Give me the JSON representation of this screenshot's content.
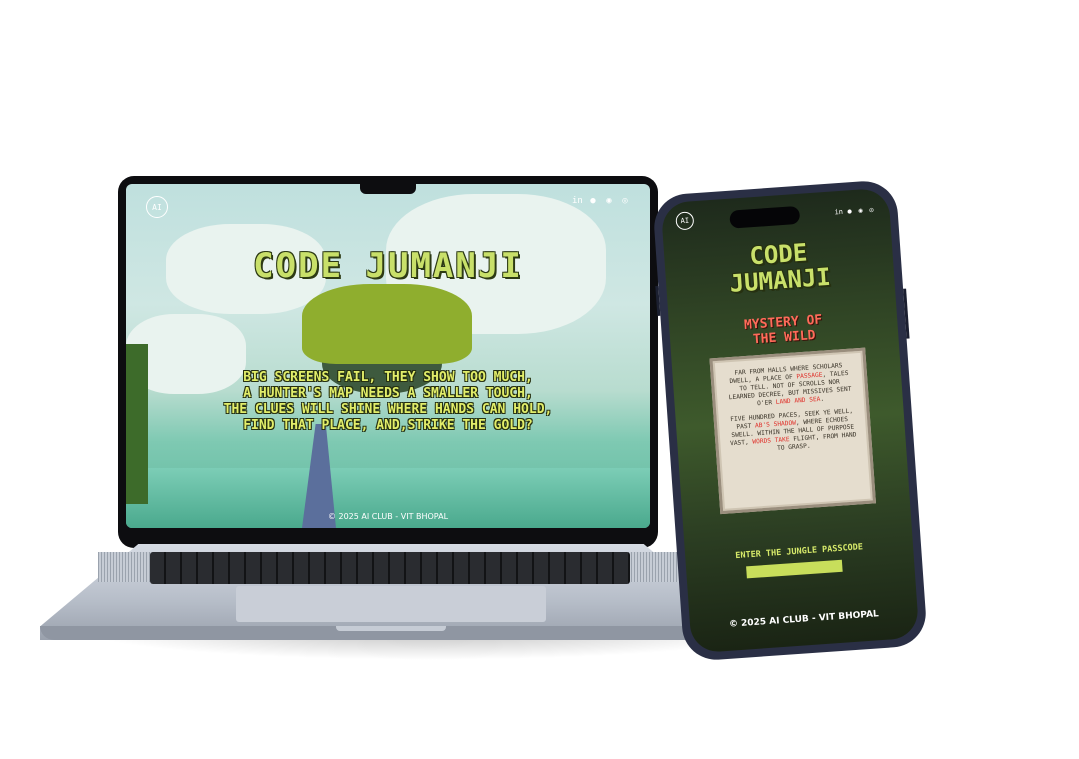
{
  "laptop": {
    "logo": "AI",
    "social_icons": [
      "linkedin-icon",
      "github-icon",
      "discord-icon",
      "instagram-icon"
    ],
    "title": "CODE JUMANJI",
    "poem_lines": [
      "BIG SCREENS FAIL, THEY SHOW TOO MUCH,",
      "A HUNTER'S MAP NEEDS A SMALLER TOUCH,",
      "THE CLUES WILL SHINE WHERE HANDS CAN HOLD,",
      "FIND THAT PLACE, AND,STRIKE THE GOLD?"
    ],
    "footer": "© 2025 AI CLUB - VIT BHOPAL"
  },
  "phone": {
    "logo": "AI",
    "title_line1": "CODE",
    "title_line2": "JUMANJI",
    "subtitle_line1": "MYSTERY OF",
    "subtitle_line2": "THE WILD",
    "stanza1": {
      "pre": "FAR FROM HALLS WHERE SCHOLARS DWELL, A PLACE OF ",
      "hl1": "PASSAGE",
      "mid": ", TALES TO TELL. NOT OF SCROLLS NOR LEARNED DECREE, BUT MISSIVES SENT O'ER ",
      "hl2": "LAND AND SEA",
      "post": "."
    },
    "stanza2": {
      "pre": "FIVE HUNDRED PACES, SEEK YE WELL, PAST ",
      "hl1": "AB'S SHADOW",
      "mid": ", WHERE ECHOES SWELL. WITHIN THE HALL OF PURPOSE VAST, ",
      "hl2": "WORDS TAKE",
      "post": " FLIGHT, FROM HAND TO GRASP."
    },
    "passcode_label": "ENTER THE JUNGLE PASSCODE",
    "passcode_value": "",
    "footer": "© 2025 AI CLUB - VIT BHOPAL"
  },
  "colors": {
    "title_green": "#c9e06a",
    "subtitle_red": "#ff6b5a",
    "highlight_red": "#e0302a",
    "input_green": "#c8de5b"
  }
}
